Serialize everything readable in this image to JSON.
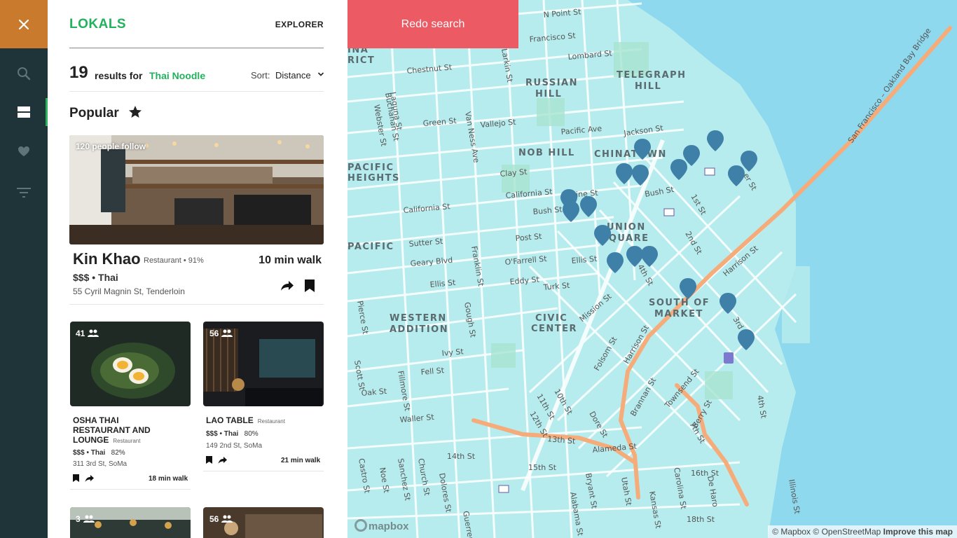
{
  "app": {
    "logo": "LOKALS",
    "nav_label": "EXPLORER"
  },
  "rail": {
    "items": [
      "close",
      "search",
      "list",
      "favorites",
      "filters"
    ],
    "accent": "#c97a2c",
    "active_indicator": "#2db35d"
  },
  "results": {
    "count": "19",
    "results_for": "results for",
    "query": "Thai Noodle",
    "sort_label": "Sort:",
    "sort_value": "Distance"
  },
  "popular": {
    "title": "Popular"
  },
  "featured": {
    "followers": "120 people follow",
    "name": "Kin Khao",
    "meta": "Restaurant • 91%",
    "walk": "10 min walk",
    "price": "$$$ • Thai",
    "address": "55 Cyril Magnin St, Tenderloin"
  },
  "cards": [
    {
      "count": "41",
      "name_l1": "OSHA THAI",
      "name_l2": "RESTAURANT AND",
      "name_l3": "LOUNGE",
      "type": "Restaurant",
      "price": "$$$ • Thai",
      "rating": "82%",
      "address": "311 3rd St, SoMa",
      "walk": "18 min walk"
    },
    {
      "count": "56",
      "name_l1": "LAO TABLE",
      "type": "Restaurant",
      "price": "$$$ • Thai",
      "rating": "80%",
      "address": "149 2nd St, SoMa",
      "walk": "21 min walk"
    },
    {
      "count": "3"
    },
    {
      "count": "56"
    }
  ],
  "map": {
    "redo_label": "Redo search",
    "redo_color": "#ec5a64",
    "attribution_1": "© Mapbox",
    "attribution_2": "© OpenStreetMap",
    "improve": "Improve this map",
    "mapbox_logo": "mapbox",
    "streets": [
      "N Point St",
      "Francisco St",
      "Lombard St",
      "Chestnut St",
      "Green St",
      "Vallejo St",
      "Pacific Ave",
      "Jackson St",
      "Clay St",
      "California St",
      "Pine St",
      "Bush St",
      "Post St",
      "Sutter St",
      "Geary Blvd",
      "O'Farrell St",
      "Ellis St",
      "Eddy St",
      "Turk St",
      "Mission St",
      "Folsom St",
      "Harrison St",
      "Brannan St",
      "Townsend St",
      "Berry St",
      "Fell St",
      "Oak St",
      "Ivy St",
      "Waller St",
      "13th St",
      "14th St",
      "15th St",
      "16th St",
      "18th St",
      "Alameda St",
      "Dore St",
      "Van Ness Ave",
      "Franklin St",
      "Gough St",
      "Laguna St",
      "Buchanan St",
      "Webster St",
      "Fillmore St",
      "Scott St",
      "Pierce St",
      "Sanchez St",
      "Noe St",
      "Church St",
      "Dolores St",
      "Guerrero St",
      "Castro St",
      "Bryant St",
      "Alabama St",
      "Utah St",
      "Kansas St",
      "Carolina St",
      "De Haro St",
      "Illinois St",
      "1st St",
      "2nd St",
      "3rd St",
      "4th St",
      "7th St",
      "10th St",
      "11th St",
      "12th St",
      "San Francisco – Oakland Bay Bridge"
    ],
    "districts": [
      "RUSSIAN",
      "HILL",
      "TELEGRAPH",
      "HILL",
      "NOB HILL",
      "CHINATOWN",
      "UNION",
      "SQUARE",
      "SOUTH OF",
      "MARKET",
      "CIVIC",
      "CENTER",
      "WESTERN",
      "ADDITION",
      "PACIFIC",
      "HEIGHTS",
      "PACIFIC",
      "MARINA",
      "DISTRICT"
    ]
  }
}
